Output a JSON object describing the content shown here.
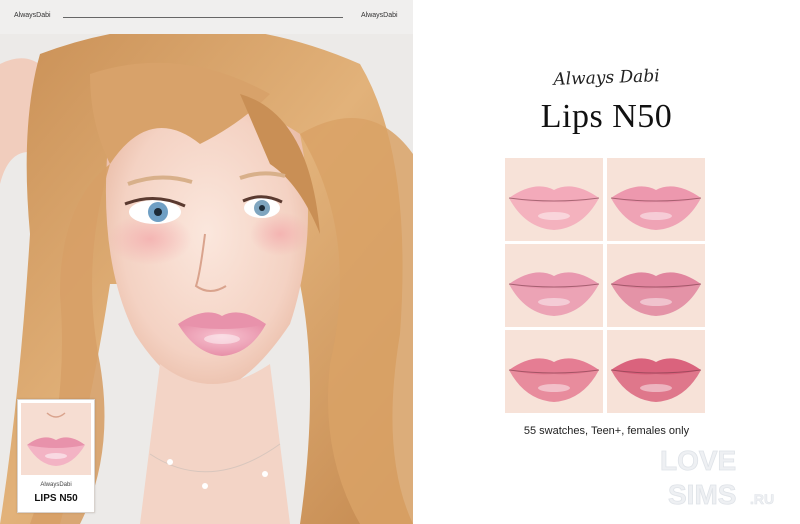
{
  "header": {
    "brand_left": "AlwaysDabi",
    "brand_right": "AlwaysDabi"
  },
  "inset": {
    "brand": "AlwaysDabi",
    "title": "LIPS N50"
  },
  "product": {
    "creator": "Always Dabi",
    "title": "Lips N50",
    "caption": "55 swatches, Teen+, females only"
  },
  "swatches": [
    {
      "color": "#f2a6b8"
    },
    {
      "color": "#ec93ac"
    },
    {
      "color": "#e893ad"
    },
    {
      "color": "#df7f9b"
    },
    {
      "color": "#e4778f"
    },
    {
      "color": "#d85c78"
    }
  ],
  "watermark": {
    "line1": "LOVE",
    "line2": "SIMS",
    "suffix": ".RU"
  },
  "colors": {
    "hair": "#d9a266",
    "skin": "#f8ddd0",
    "accent": "#e992ad"
  }
}
